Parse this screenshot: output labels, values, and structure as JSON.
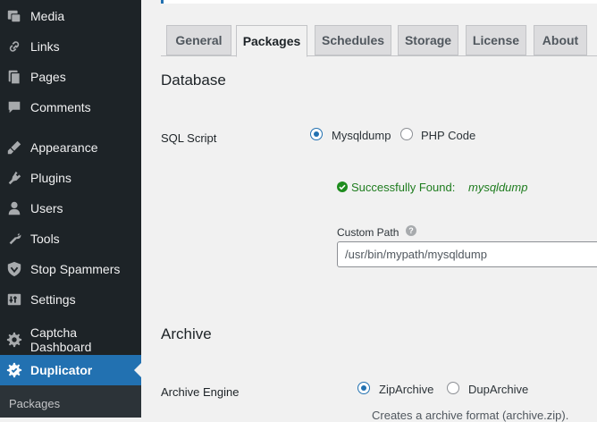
{
  "sidebar": {
    "items": [
      {
        "label": "Media",
        "icon": "media-icon"
      },
      {
        "label": "Links",
        "icon": "links-icon"
      },
      {
        "label": "Pages",
        "icon": "pages-icon"
      },
      {
        "label": "Comments",
        "icon": "comments-icon"
      },
      {
        "label": "Appearance",
        "icon": "appearance-icon"
      },
      {
        "label": "Plugins",
        "icon": "plugins-icon"
      },
      {
        "label": "Users",
        "icon": "users-icon"
      },
      {
        "label": "Tools",
        "icon": "tools-icon"
      },
      {
        "label": "Stop Spammers",
        "icon": "shield-icon"
      },
      {
        "label": "Settings",
        "icon": "settings-icon"
      },
      {
        "label": "Captcha Dashboard",
        "icon": "gear-icon"
      },
      {
        "label": "Duplicator",
        "icon": "duplicator-icon"
      }
    ],
    "active_item": "Duplicator",
    "submenu": {
      "packages_label": "Packages"
    }
  },
  "tabs": [
    {
      "label": "General"
    },
    {
      "label": "Packages"
    },
    {
      "label": "Schedules"
    },
    {
      "label": "Storage"
    },
    {
      "label": "License"
    },
    {
      "label": "About"
    }
  ],
  "active_tab": "Packages",
  "database": {
    "title": "Database",
    "sql_script": {
      "label": "SQL Script",
      "options": [
        "Mysqldump",
        "PHP Code"
      ],
      "selected": "Mysqldump",
      "found_text": "Successfully Found:",
      "found_value": "mysqldump",
      "custom_path_label": "Custom Path",
      "custom_path_value": "/usr/bin/mypath/mysqldump"
    }
  },
  "archive": {
    "title": "Archive",
    "engine": {
      "label": "Archive Engine",
      "options": [
        "ZipArchive",
        "DupArchive"
      ],
      "selected": "ZipArchive",
      "description": "Creates a archive format (archive.zip)."
    }
  },
  "colors": {
    "accent": "#2271b1",
    "sidebar_bg": "#1d2327",
    "success": "#1e8c1e"
  }
}
